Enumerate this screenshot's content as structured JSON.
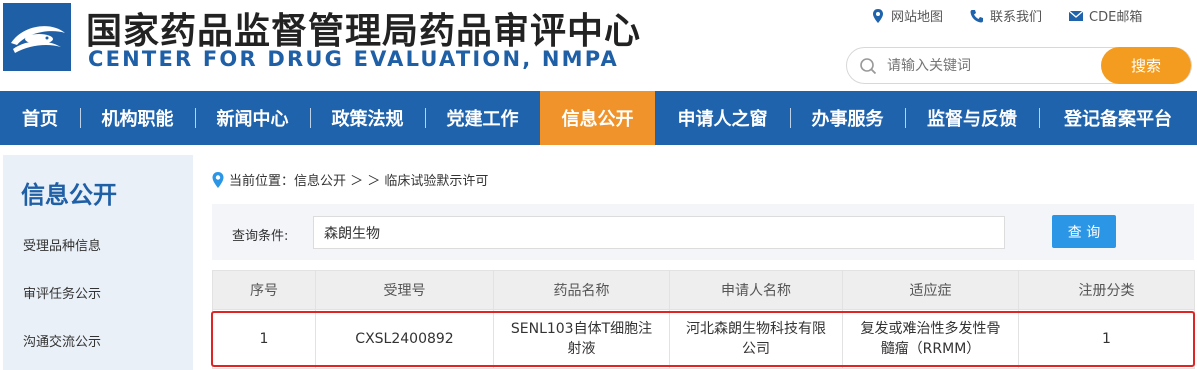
{
  "header": {
    "title_cn": "国家药品监督管理局药品审评中心",
    "title_en": "CENTER FOR DRUG EVALUATION, NMPA",
    "toplinks": [
      "网站地图",
      "联系我们",
      "CDE邮箱"
    ],
    "search_placeholder": "请输入关键词",
    "search_button": "搜索"
  },
  "nav": {
    "items": [
      "首页",
      "机构职能",
      "新闻中心",
      "政策法规",
      "党建工作",
      "信息公开",
      "申请人之窗",
      "办事服务",
      "监督与反馈",
      "登记备案平台"
    ],
    "active": "信息公开"
  },
  "sidebar": {
    "title": "信息公开",
    "items": [
      "受理品种信息",
      "审评任务公示",
      "沟通交流公示"
    ]
  },
  "breadcrumb": {
    "text": "当前位置：信息公开 ＞ ＞ 临床试验默示许可"
  },
  "query": {
    "label": "查询条件:",
    "value": "森朗生物",
    "button": "查 询"
  },
  "table": {
    "headers": [
      "序号",
      "受理号",
      "药品名称",
      "申请人名称",
      "适应症",
      "注册分类"
    ],
    "rows": [
      [
        "1",
        "CXSL2400892",
        "SENL103自体T细胞注射液",
        "河北森朗生物科技有限公司",
        "复发或难治性多发性骨髓瘤（RRMM）",
        "1"
      ]
    ]
  },
  "colors": {
    "brand_blue": "#1f63ad",
    "nav_active": "#f0932b",
    "search_button": "#f39c1f",
    "query_button": "#2b95e6",
    "highlight": "#e02424"
  }
}
